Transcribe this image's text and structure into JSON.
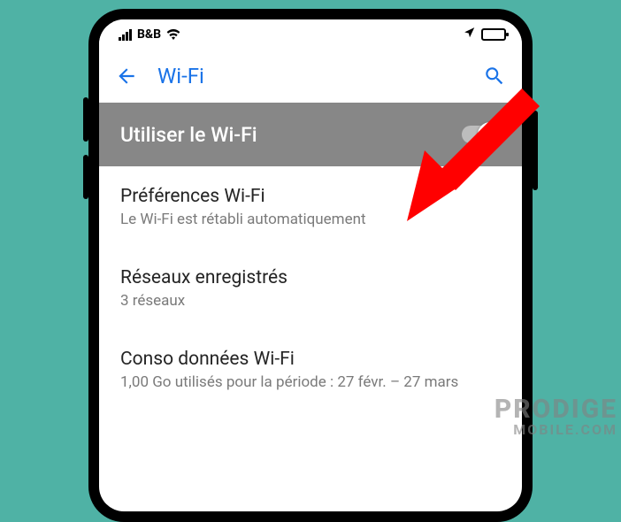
{
  "status": {
    "carrier": "B&B"
  },
  "appbar": {
    "title": "Wi-Fi"
  },
  "toggle": {
    "label": "Utiliser le Wi-Fi"
  },
  "items": [
    {
      "title": "Préférences Wi-Fi",
      "subtitle": "Le Wi-Fi est rétabli automatiquement"
    },
    {
      "title": "Réseaux enregistrés",
      "subtitle": "3 réseaux"
    },
    {
      "title": "Conso données Wi-Fi",
      "subtitle": "1,00 Go utilisés pour la période : 27 févr. – 27 mars"
    }
  ],
  "watermark": {
    "line1": "PRODIGE",
    "line2": "MOBILE.COM"
  }
}
